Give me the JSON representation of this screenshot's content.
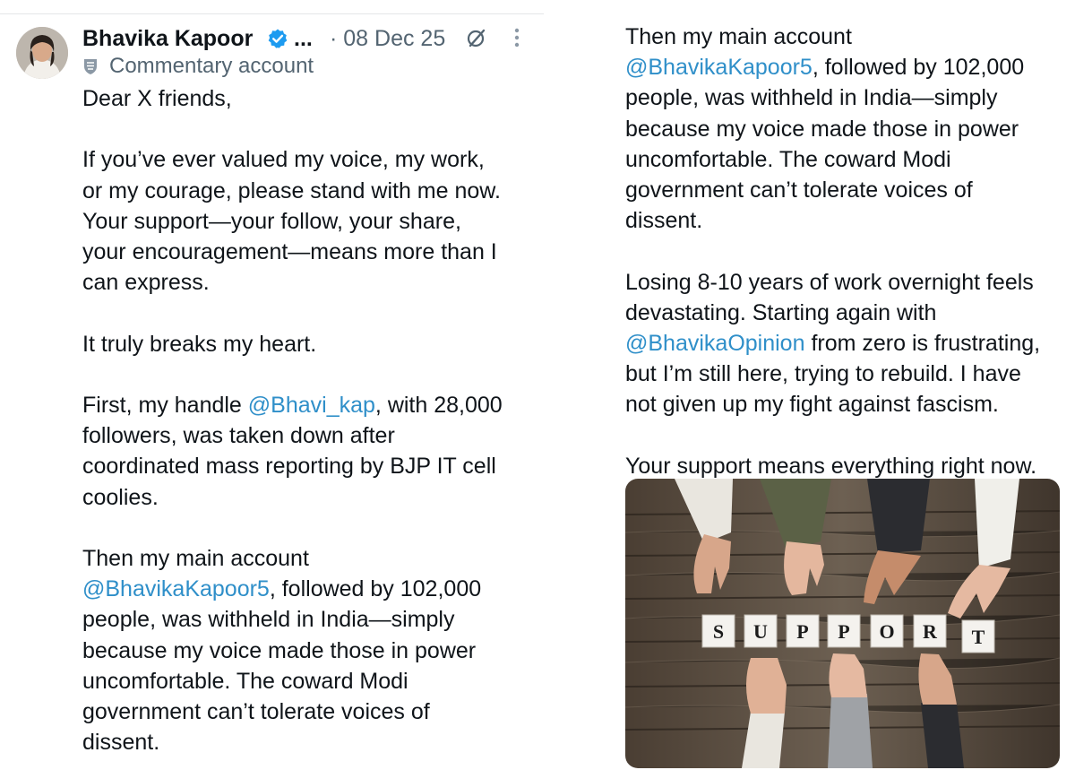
{
  "post": {
    "author_name": "Bhavika Kapoor",
    "ellipsis": "...",
    "date": "· 08 Dec 25",
    "label": "Commentary account",
    "icons": [
      "avatar",
      "verified-badge-icon",
      "grok-icon",
      "more-options-icon",
      "commentary-label-icon"
    ]
  },
  "left_column": [
    "Dear X friends,",
    "",
    "If you’ve ever valued my voice, my work,",
    "or my courage, please stand with me now.",
    "Your support—your follow, your share,",
    "your encouragement—means more than I",
    "can express.",
    "",
    "It truly breaks my heart.",
    "",
    {
      "before": "First, my handle ",
      "mention": "@Bhavi_kap",
      "after": ", with 28,000"
    },
    "followers, was taken down after",
    "coordinated mass reporting by BJP IT cell",
    "coolies.",
    "",
    "Then my main account",
    {
      "before": "",
      "mention": "@BhavikaKapoor5",
      "after": ",  followed by 102,000"
    },
    "people, was withheld in India—simply",
    "because my voice made those in power",
    "uncomfortable. The coward Modi",
    "government can’t tolerate voices of",
    "dissent."
  ],
  "right_column": [
    "Then my main account",
    {
      "before": "",
      "mention": "@BhavikaKapoor5",
      "after": ",  followed by 102,000"
    },
    "people, was withheld in India—simply",
    "because my voice made those in power",
    "uncomfortable. The coward Modi",
    "government can’t tolerate voices of",
    "dissent.",
    "",
    "Losing 8-10 years of work overnight feels",
    "devastating. Starting again with",
    {
      "before": "",
      "mention": "@BhavikaOpinion",
      "after": " from zero is frustrating,"
    },
    "but I’m still here, trying to rebuild. I have",
    "not given up my fight against fascism.",
    "",
    "Your support means everything right now."
  ],
  "image": {
    "tiles": [
      "S",
      "U",
      "P",
      "P",
      "O",
      "R",
      "T"
    ]
  },
  "colors": {
    "text": "#0f1419",
    "secondary": "#536471",
    "mention": "#2f8fc9",
    "verified": "#1d9bf0"
  }
}
